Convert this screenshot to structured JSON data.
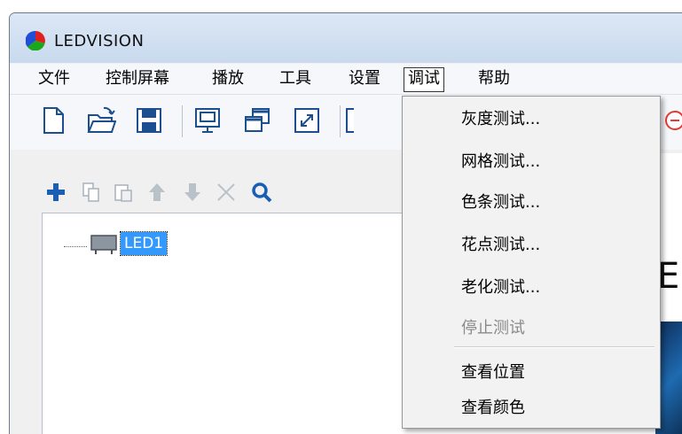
{
  "app": {
    "title": "LEDVISION"
  },
  "menubar": {
    "items": [
      "文件",
      "控制屏幕",
      "播放",
      "工具",
      "设置",
      "调试",
      "帮助"
    ],
    "active": "调试"
  },
  "tree": {
    "node_label": "LED1"
  },
  "right_pane": {
    "partial_text": "E"
  },
  "debug_menu": {
    "items": [
      {
        "label": "灰度测试...",
        "enabled": true
      },
      {
        "label": "网格测试...",
        "enabled": true
      },
      {
        "label": "色条测试...",
        "enabled": true
      },
      {
        "label": "花点测试...",
        "enabled": true
      },
      {
        "label": "老化测试...",
        "enabled": true
      },
      {
        "label": "停止测试",
        "enabled": false
      },
      {
        "label": "查看位置",
        "enabled": true
      },
      {
        "label": "查看颜色",
        "enabled": true
      }
    ]
  },
  "colors": {
    "selection": "#3399ff",
    "plus_icon": "#1a5fb4",
    "search_icon": "#1a5fb4",
    "stop_icon": "#e53935"
  },
  "icons": [
    "new-file-icon",
    "open-folder-icon",
    "save-icon",
    "screen-icon",
    "windows-icon",
    "fullscreen-icon",
    "add-icon",
    "copy-icon",
    "paste-icon",
    "move-up-icon",
    "move-down-icon",
    "delete-icon",
    "search-icon",
    "led-screen-icon",
    "stop-icon"
  ]
}
